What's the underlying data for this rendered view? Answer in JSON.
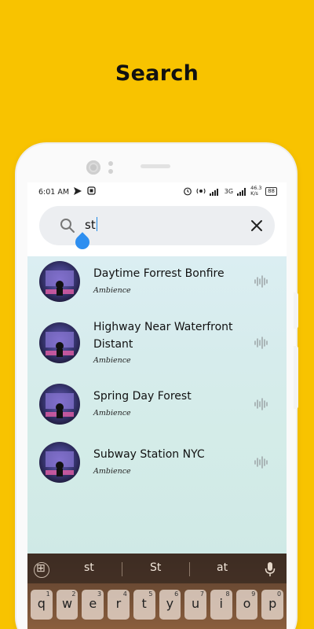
{
  "promo": {
    "title": "Search"
  },
  "status": {
    "time": "6:01 AM",
    "network": "3G",
    "speed": "46.3 K/s",
    "battery": "88"
  },
  "search": {
    "value": "st",
    "placeholder": ""
  },
  "results": [
    {
      "title": "Daytime Forrest Bonfire",
      "category": "Ambience"
    },
    {
      "title": "Highway Near Waterfront Distant",
      "category": "Ambience"
    },
    {
      "title": "Spring Day Forest",
      "category": "Ambience"
    },
    {
      "title": "Subway Station NYC",
      "category": "Ambience"
    }
  ],
  "keyboard": {
    "suggestions": [
      "st",
      "St",
      "at"
    ],
    "row1": [
      "q",
      "w",
      "e",
      "r",
      "t",
      "y",
      "u",
      "i",
      "o",
      "p"
    ],
    "row1_hints": [
      "1",
      "2",
      "3",
      "4",
      "5",
      "6",
      "7",
      "8",
      "9",
      "0"
    ]
  },
  "colors": {
    "background": "#f8c300",
    "accent": "#1e88e5"
  },
  "icons": {
    "search": "search-icon",
    "clear": "close-icon",
    "waveform": "waveform-icon",
    "mic": "mic-icon",
    "apps": "apps-grid-icon"
  }
}
